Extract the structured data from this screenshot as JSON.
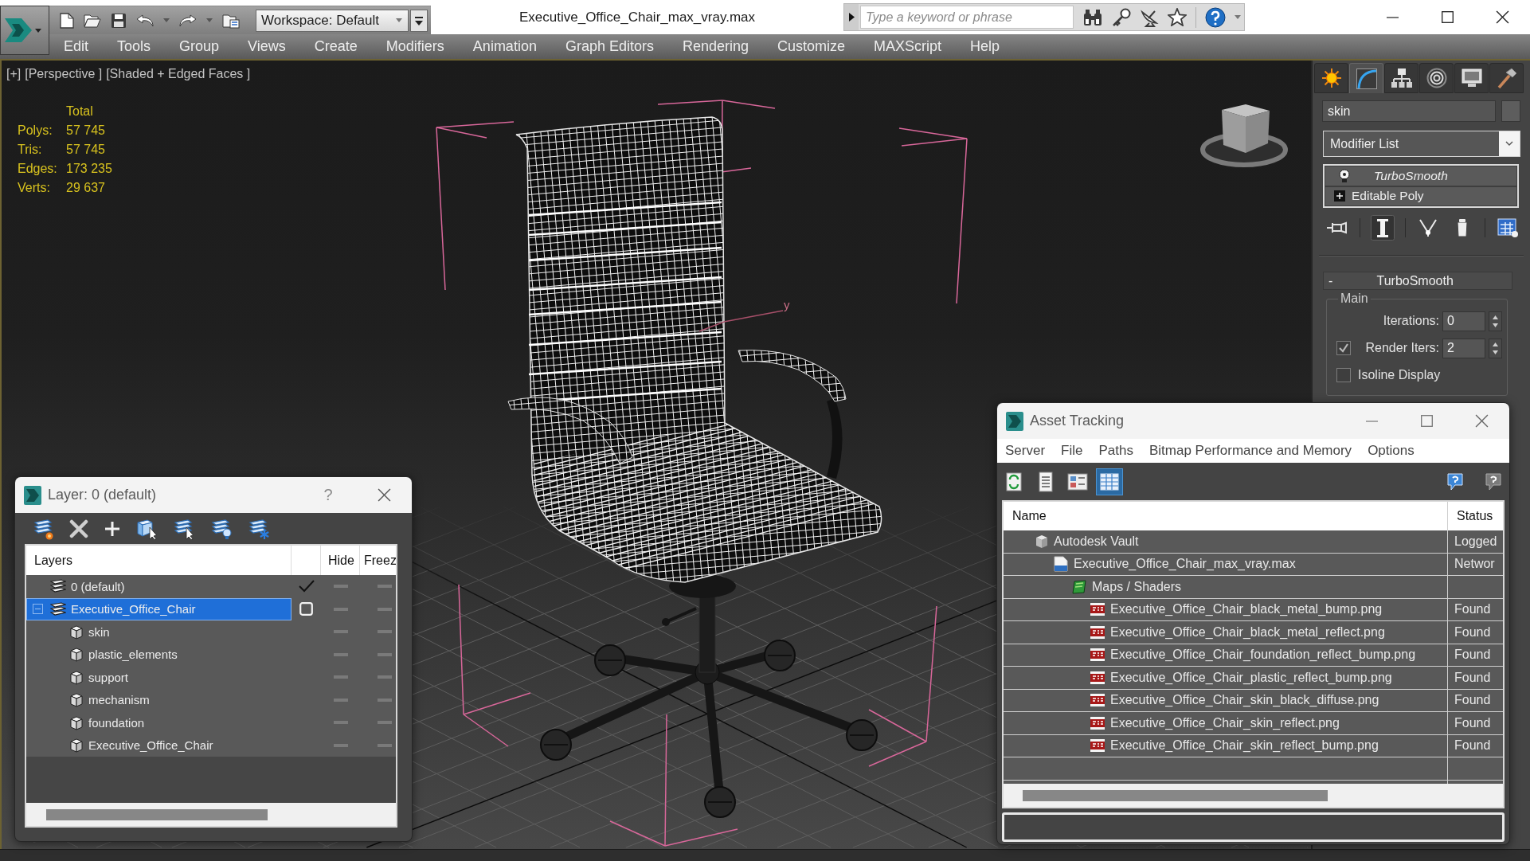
{
  "window": {
    "title": "Executive_Office_Chair_max_vray.max",
    "workspace": "Workspace: Default",
    "search": {
      "placeholder": "Type a keyword or phrase"
    }
  },
  "menu": [
    "Edit",
    "Tools",
    "Group",
    "Views",
    "Create",
    "Modifiers",
    "Animation",
    "Graph Editors",
    "Rendering",
    "Customize",
    "MAXScript",
    "Help"
  ],
  "viewport": {
    "labels": [
      "[+]",
      "[Perspective ]",
      "[Shaded + Edged Faces ]"
    ],
    "stats": {
      "heading": "Total",
      "rows": [
        {
          "label": "Polys:",
          "value": "57 745"
        },
        {
          "label": "Tris:",
          "value": "57 745"
        },
        {
          "label": "Edges:",
          "value": "173 235"
        },
        {
          "label": "Verts:",
          "value": "29 637"
        }
      ]
    },
    "axis_label": "y"
  },
  "command_panel": {
    "tabs": [
      {
        "kind": "create",
        "selected": false
      },
      {
        "kind": "modify",
        "selected": true
      },
      {
        "kind": "hierarchy",
        "selected": false
      },
      {
        "kind": "motion",
        "selected": false
      },
      {
        "kind": "display",
        "selected": false
      },
      {
        "kind": "utilities",
        "selected": false
      }
    ],
    "object_name": "skin",
    "modifier_list": "Modifier List",
    "stack": [
      {
        "kind": "modifier",
        "label": "TurboSmooth"
      },
      {
        "kind": "object",
        "label": "Editable Poly"
      }
    ],
    "stack_tools": [
      {
        "kind": "pin",
        "selected": false
      },
      {
        "kind": "end_result",
        "selected": true
      },
      {
        "kind": "make_unique",
        "selected": false
      },
      {
        "kind": "remove",
        "selected": false
      },
      {
        "kind": "configure",
        "selected": false
      }
    ],
    "rollout": {
      "toggle": "-",
      "title": "TurboSmooth",
      "group": "Main",
      "params": [
        {
          "kind": "spinner",
          "label": "Iterations:",
          "value": "0"
        },
        {
          "kind": "checked_spinner",
          "label": "Render Iters:",
          "value": "2",
          "checked": true
        },
        {
          "kind": "checkbox",
          "label": "Isoline Display",
          "checked": false
        }
      ]
    }
  },
  "layer_dialog": {
    "title": "Layer: 0 (default)",
    "help": "?",
    "columns": {
      "name": "Layers",
      "hide": "Hide",
      "freeze": "Freez"
    },
    "layers": [
      {
        "name": "0 (default)",
        "selected": false,
        "current": true,
        "hidden": false,
        "frozen": false
      },
      {
        "name": "Executive_Office_Chair",
        "selected": true,
        "current": false,
        "expanded": true,
        "hidden": false,
        "frozen": false,
        "children": [
          {
            "name": "skin",
            "selected": false,
            "hidden": false,
            "frozen": false
          },
          {
            "name": "plastic_elements",
            "selected": false,
            "hidden": false,
            "frozen": false
          },
          {
            "name": "support",
            "selected": false,
            "hidden": false,
            "frozen": false
          },
          {
            "name": "mechanism",
            "selected": false,
            "hidden": false,
            "frozen": false
          },
          {
            "name": "foundation",
            "selected": false,
            "hidden": false,
            "frozen": false
          },
          {
            "name": "Executive_Office_Chair",
            "selected": false,
            "hidden": false,
            "frozen": false
          }
        ]
      }
    ]
  },
  "asset_tracking": {
    "title": "Asset Tracking",
    "menu": [
      "Server",
      "File",
      "Paths",
      "Bitmap Performance and Memory",
      "Options"
    ],
    "toolbar": [
      {
        "kind": "refresh",
        "selected": false
      },
      {
        "kind": "list",
        "selected": false
      },
      {
        "kind": "thumbnails",
        "selected": false
      },
      {
        "kind": "table",
        "selected": true
      }
    ],
    "columns": {
      "name": "Name",
      "status": "Status"
    },
    "assets": [
      {
        "kind": "vault",
        "name": "Autodesk Vault",
        "status": "Logged",
        "children": [
          {
            "kind": "max_file",
            "name": "Executive_Office_Chair_max_vray.max",
            "status": "Networ",
            "children": [
              {
                "kind": "folder",
                "name": "Maps / Shaders",
                "children": [
                  {
                    "kind": "png",
                    "name": "Executive_Office_Chair_black_metal_bump.png",
                    "status": "Found"
                  },
                  {
                    "kind": "png",
                    "name": "Executive_Office_Chair_black_metal_reflect.png",
                    "status": "Found"
                  },
                  {
                    "kind": "png",
                    "name": "Executive_Office_Chair_foundation_reflect_bump.png",
                    "status": "Found"
                  },
                  {
                    "kind": "png",
                    "name": "Executive_Office_Chair_plastic_reflect_bump.png",
                    "status": "Found"
                  },
                  {
                    "kind": "png",
                    "name": "Executive_Office_Chair_skin_black_diffuse.png",
                    "status": "Found"
                  },
                  {
                    "kind": "png",
                    "name": "Executive_Office_Chair_skin_reflect.png",
                    "status": "Found"
                  },
                  {
                    "kind": "png",
                    "name": "Executive_Office_Chair_skin_reflect_bump.png",
                    "status": "Found"
                  }
                ]
              }
            ]
          }
        ]
      }
    ]
  }
}
